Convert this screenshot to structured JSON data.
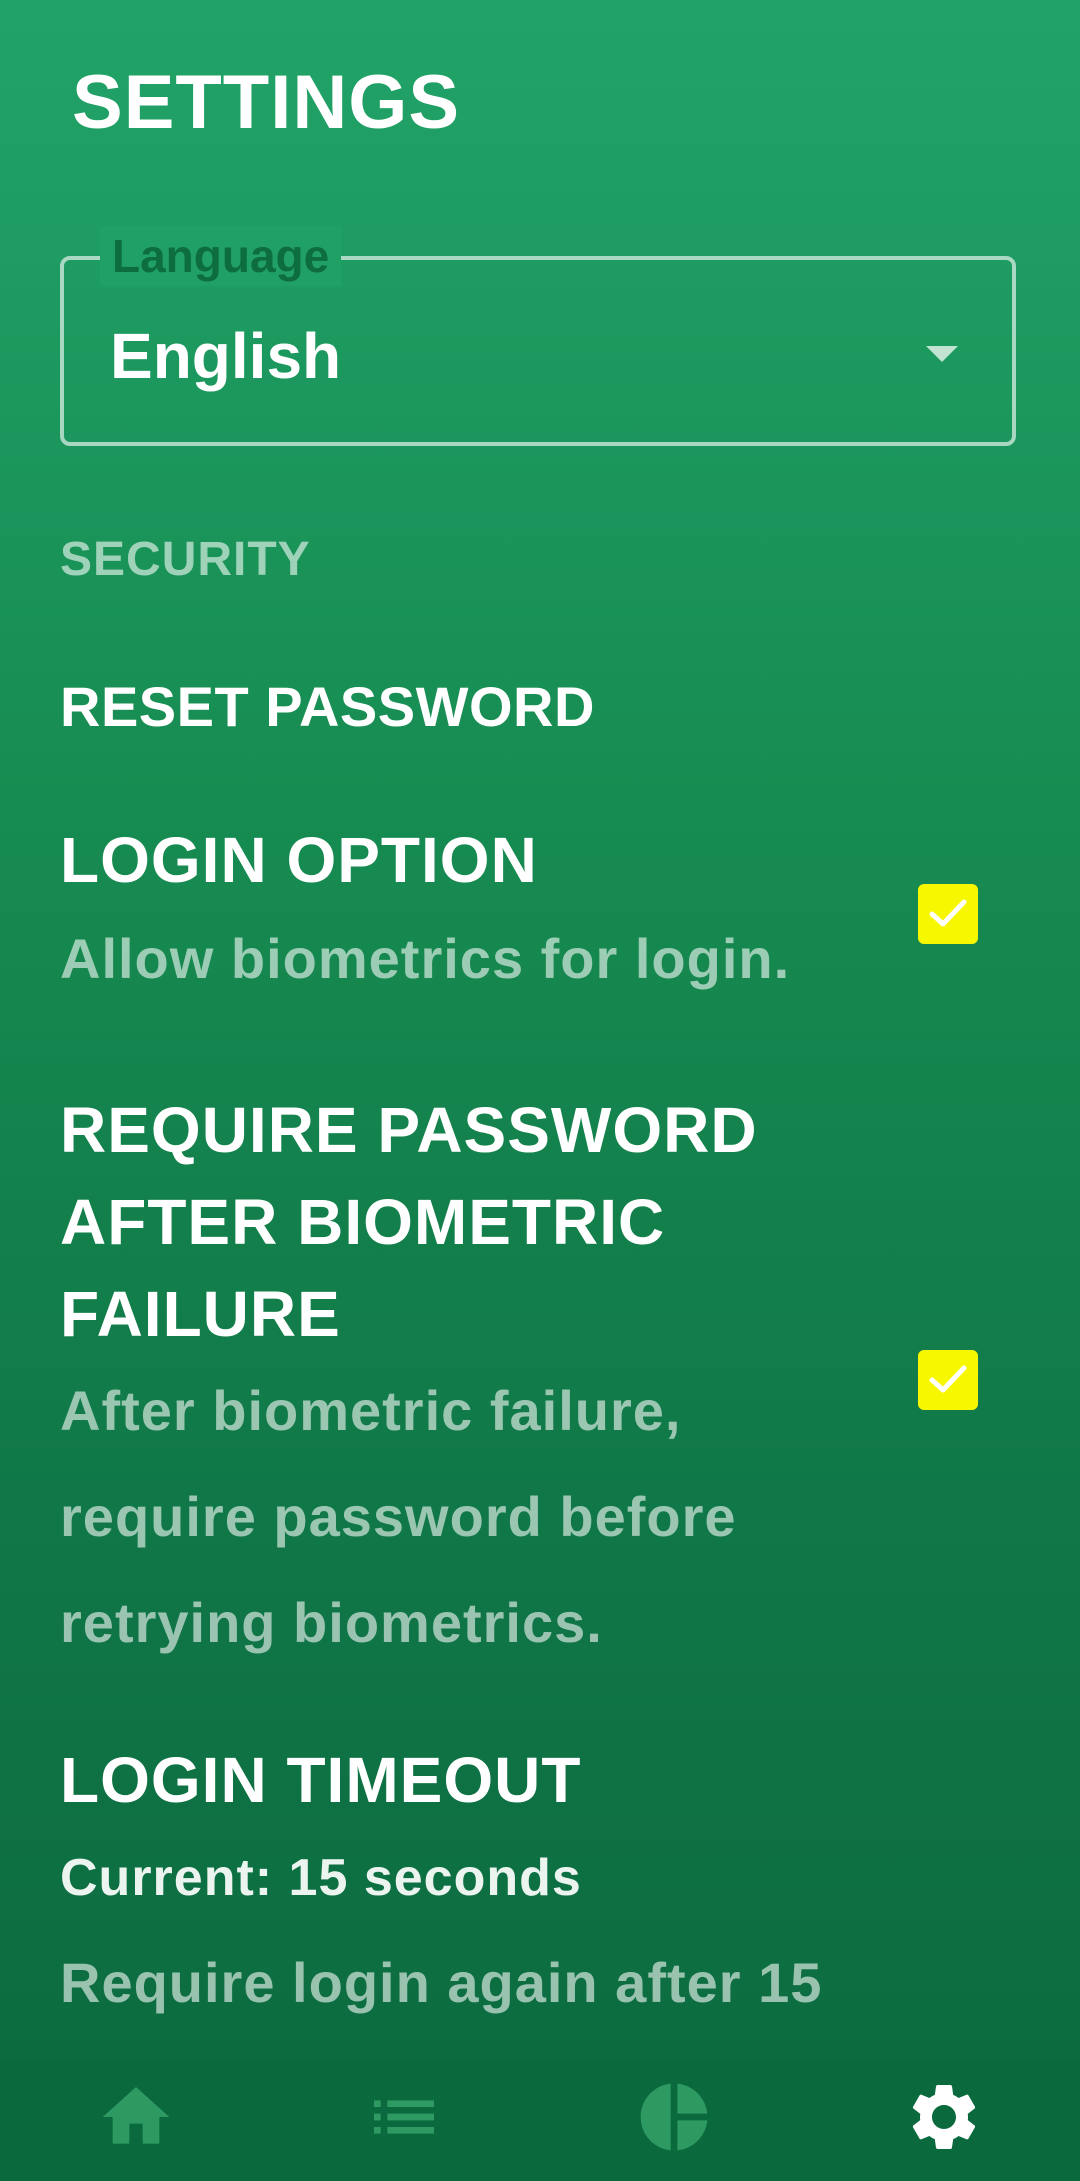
{
  "page": {
    "title": "SETTINGS"
  },
  "language": {
    "label": "Language",
    "value": "English"
  },
  "security": {
    "header": "SECURITY",
    "reset_password": "RESET PASSWORD",
    "login_option": {
      "title": "LOGIN OPTION",
      "description": "Allow biometrics for login.",
      "checked": true
    },
    "require_password": {
      "title": "REQUIRE PASSWORD AFTER BIOMETRIC FAILURE",
      "description": "After biometric failure, require password before retrying biometrics.",
      "checked": true
    },
    "login_timeout": {
      "title": "LOGIN TIMEOUT",
      "current": "Current: 15 seconds",
      "description": "Require login again after 15"
    }
  },
  "nav": {
    "items": [
      {
        "icon": "home-icon"
      },
      {
        "icon": "list-icon"
      },
      {
        "icon": "pie-chart-icon"
      },
      {
        "icon": "gear-icon",
        "active": true
      }
    ]
  },
  "colors": {
    "accent_checkbox": "#f7f700",
    "background_top": "#21a368",
    "background_bottom": "#0b6a3e"
  }
}
